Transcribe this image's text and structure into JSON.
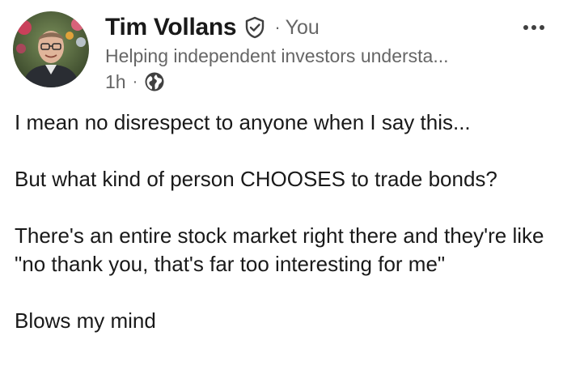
{
  "author": {
    "name": "Tim Vollans",
    "badge_icon": "verified-shield-icon",
    "separator": "·",
    "relation": "You",
    "headline": "Helping independent investors understa..."
  },
  "meta": {
    "time": "1h",
    "separator": "·",
    "visibility_icon": "globe-icon"
  },
  "menu": {
    "icon": "more-options-icon"
  },
  "post": {
    "paragraphs": [
      "I mean no disrespect to anyone when I say this...",
      "But what kind of person CHOOSES to trade bonds?",
      "There's an entire stock market right there and they're like \"no thank you, that's far too interesting for me\"",
      "Blows my mind"
    ]
  },
  "colors": {
    "primary_text": "#191919",
    "secondary_text": "#666666",
    "background": "#ffffff"
  }
}
